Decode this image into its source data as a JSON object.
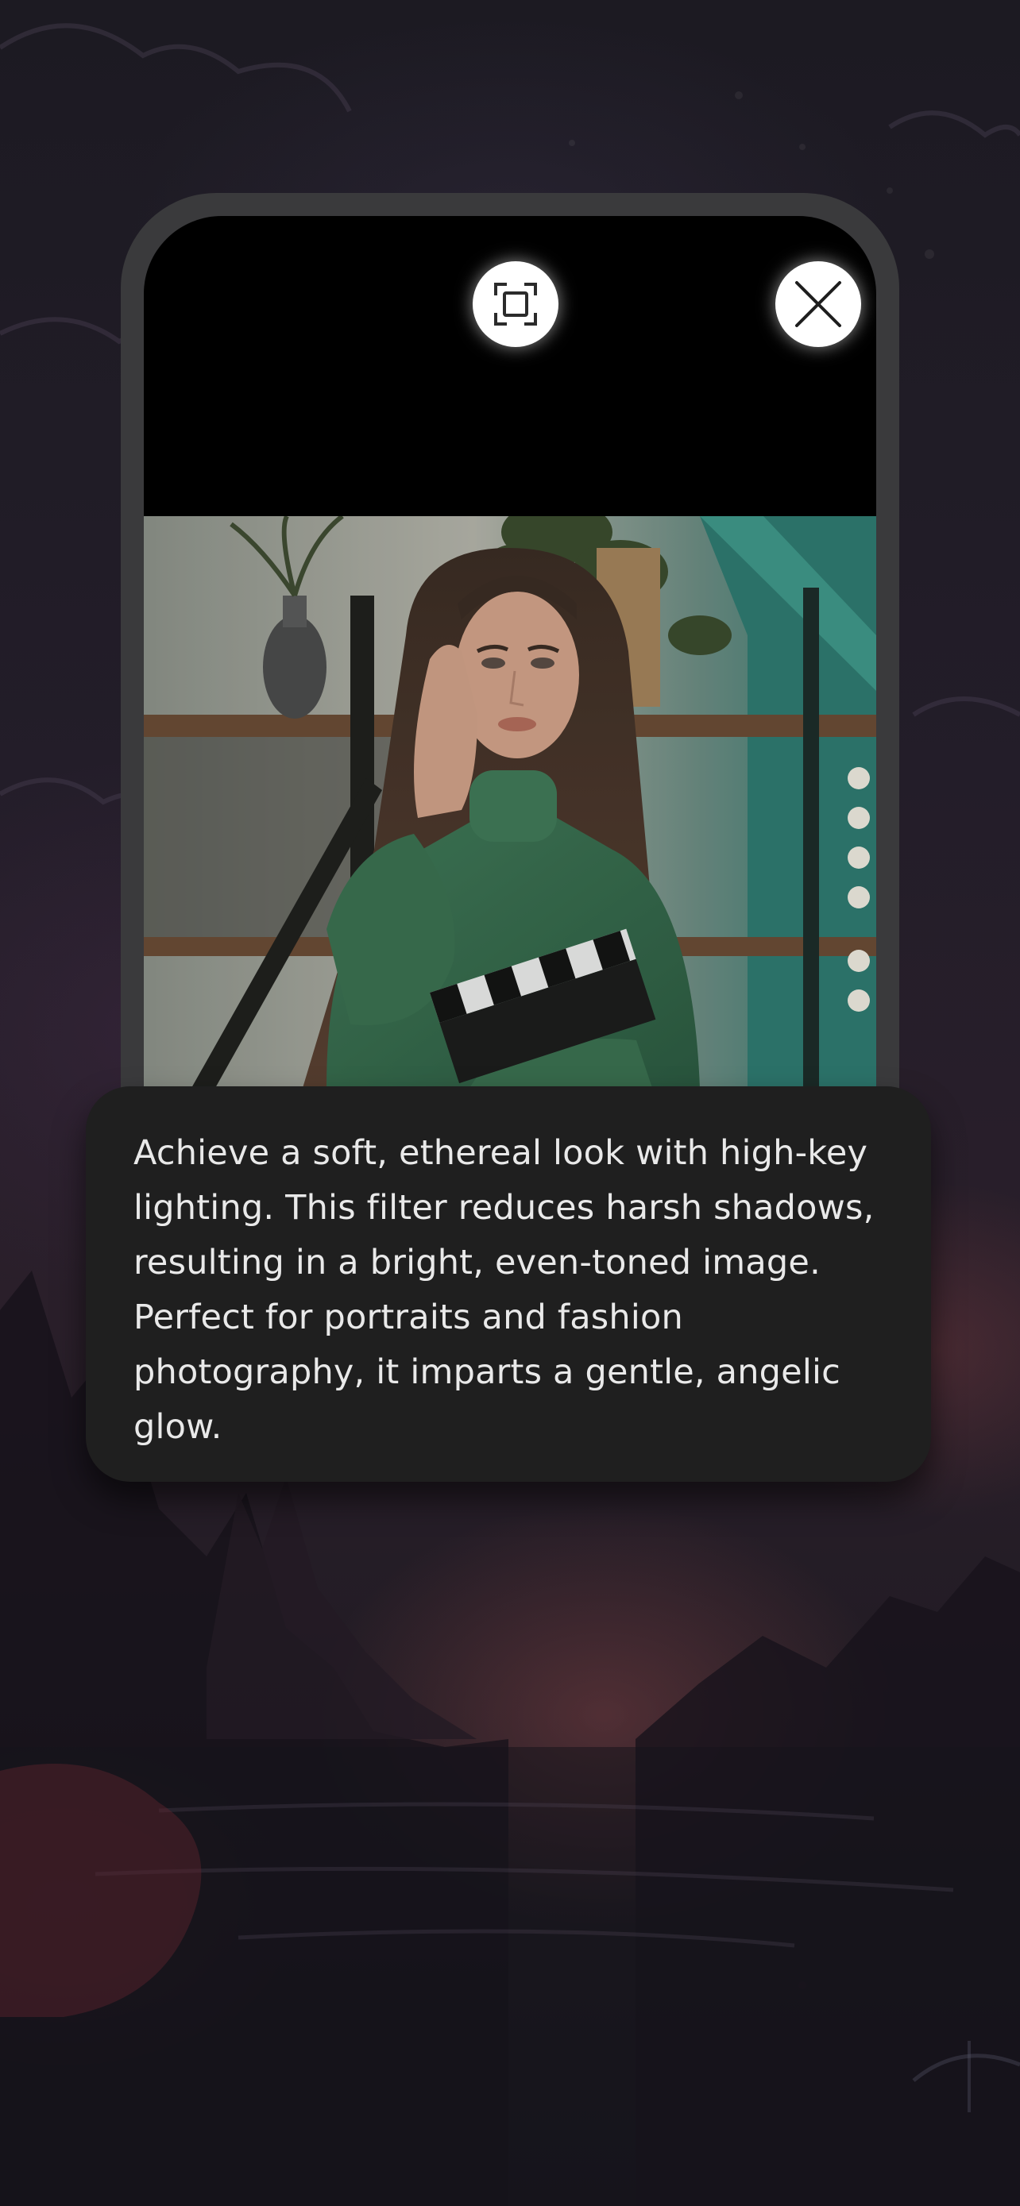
{
  "viewer": {
    "toolbar": {
      "frame_icon": "fit-frame-icon",
      "close_icon": "close-icon"
    },
    "photo": {
      "subject": "portrait-photo"
    },
    "description": "Achieve a soft, ethereal look with high-key lighting. This filter reduces harsh shadows, resulting in a bright, even-toned image. Perfect for portraits and fashion photography, it imparts a gentle, angelic glow."
  },
  "colors": {
    "card_background": "#1f1f1f",
    "frame": "#3a3a3c",
    "button": "#ffffff"
  }
}
